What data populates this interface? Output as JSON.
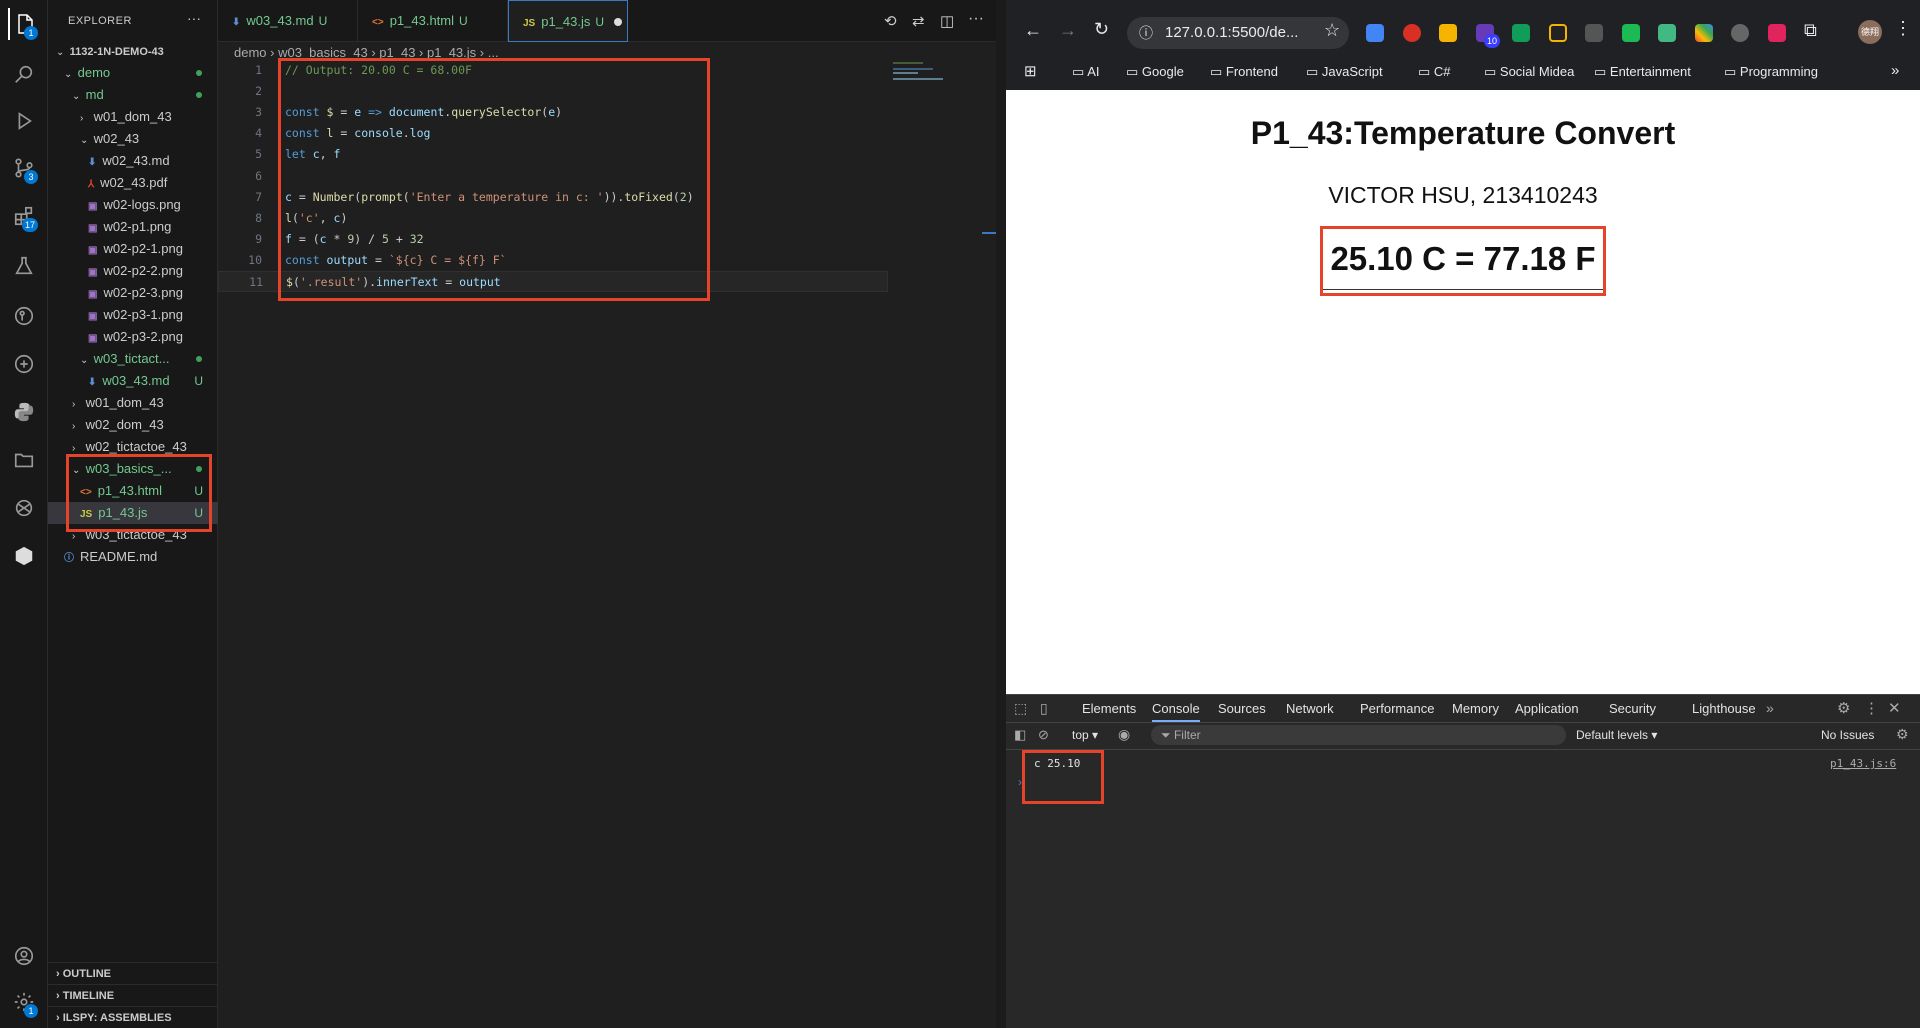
{
  "vscode": {
    "activity_badges": {
      "explorer": "1",
      "scm": "3",
      "extensions": "17",
      "settings": "1"
    },
    "explorer": {
      "title": "EXPLORER",
      "more": "···",
      "tree": [
        {
          "label": "1132-1N-DEMO-43",
          "indent": 0,
          "chev": "⌄",
          "bold": true,
          "color": "#cccccc"
        },
        {
          "label": "demo",
          "indent": 1,
          "chev": "⌄",
          "color": "#73c991",
          "dot": true
        },
        {
          "label": "md",
          "indent": 2,
          "chev": "⌄",
          "color": "#73c991",
          "dot": true
        },
        {
          "label": "w01_dom_43",
          "indent": 3,
          "chev": "›",
          "color": "#cccccc"
        },
        {
          "label": "w02_43",
          "indent": 3,
          "chev": "⌄",
          "color": "#cccccc"
        },
        {
          "label": "w02_43.md",
          "indent": 4,
          "icon": "⬇",
          "iconColor": "#5b8fd1",
          "color": "#cccccc"
        },
        {
          "label": "w02_43.pdf",
          "indent": 4,
          "icon": "⅄",
          "iconColor": "#e5442a",
          "color": "#cccccc"
        },
        {
          "label": "w02-logs.png",
          "indent": 4,
          "icon": "▣",
          "iconColor": "#a074c4",
          "color": "#cccccc"
        },
        {
          "label": "w02-p1.png",
          "indent": 4,
          "icon": "▣",
          "iconColor": "#a074c4",
          "color": "#cccccc"
        },
        {
          "label": "w02-p2-1.png",
          "indent": 4,
          "icon": "▣",
          "iconColor": "#a074c4",
          "color": "#cccccc"
        },
        {
          "label": "w02-p2-2.png",
          "indent": 4,
          "icon": "▣",
          "iconColor": "#a074c4",
          "color": "#cccccc"
        },
        {
          "label": "w02-p2-3.png",
          "indent": 4,
          "icon": "▣",
          "iconColor": "#a074c4",
          "color": "#cccccc"
        },
        {
          "label": "w02-p3-1.png",
          "indent": 4,
          "icon": "▣",
          "iconColor": "#a074c4",
          "color": "#cccccc"
        },
        {
          "label": "w02-p3-2.png",
          "indent": 4,
          "icon": "▣",
          "iconColor": "#a074c4",
          "color": "#cccccc"
        },
        {
          "label": "w03_tictact...",
          "indent": 3,
          "chev": "⌄",
          "color": "#73c991",
          "dot": true
        },
        {
          "label": "w03_43.md",
          "indent": 4,
          "icon": "⬇",
          "iconColor": "#5b8fd1",
          "color": "#73c991",
          "u": "U"
        },
        {
          "label": "w01_dom_43",
          "indent": 2,
          "chev": "›",
          "color": "#cccccc"
        },
        {
          "label": "w02_dom_43",
          "indent": 2,
          "chev": "›",
          "color": "#cccccc"
        },
        {
          "label": "w02_tictactoe_43",
          "indent": 2,
          "chev": "›",
          "color": "#cccccc"
        },
        {
          "label": "w03_basics_...",
          "indent": 2,
          "chev": "⌄",
          "color": "#73c991",
          "dot": true
        },
        {
          "label": "p1_43.html",
          "indent": 3,
          "icon": "<>",
          "iconColor": "#e37933",
          "color": "#73c991",
          "u": "U"
        },
        {
          "label": "p1_43.js",
          "indent": 3,
          "icon": "JS",
          "iconColor": "#cbcb41",
          "color": "#73c991",
          "u": "U",
          "selected": true
        },
        {
          "label": "w03_tictactoe_43",
          "indent": 2,
          "chev": "›",
          "color": "#cccccc"
        },
        {
          "label": "README.md",
          "indent": 1,
          "icon": "ⓘ",
          "iconColor": "#5b8fd1",
          "color": "#cccccc"
        }
      ],
      "bottom": [
        "OUTLINE",
        "TIMELINE",
        "ILSPY: ASSEMBLIES"
      ]
    },
    "tabs": [
      {
        "label": "w03_43.md",
        "u": "U",
        "icon": "⬇",
        "iconColor": "#5b8fd1"
      },
      {
        "label": "p1_43.html",
        "u": "U",
        "icon": "<>",
        "iconColor": "#e37933"
      },
      {
        "label": "p1_43.js",
        "u": "U",
        "icon": "JS",
        "iconColor": "#cbcb41",
        "active": true
      }
    ],
    "breadcrumb": [
      "demo",
      "w03_basics_43",
      "p1_43",
      "p1_43.js",
      "..."
    ],
    "code": [
      [
        [
          "// Output: 20.00 C = 68.00F",
          "c"
        ]
      ],
      [],
      [
        [
          "const ",
          "k"
        ],
        [
          "$ ",
          "f"
        ],
        [
          "= ",
          "t"
        ],
        [
          "e ",
          "v"
        ],
        [
          "=> ",
          "k"
        ],
        [
          "document",
          "v"
        ],
        [
          ".",
          "t"
        ],
        [
          "querySelector",
          "f"
        ],
        [
          "(",
          "t"
        ],
        [
          "e",
          "v"
        ],
        [
          ")",
          "t"
        ]
      ],
      [
        [
          "const ",
          "k"
        ],
        [
          "l ",
          "f"
        ],
        [
          "= ",
          "t"
        ],
        [
          "console",
          "v"
        ],
        [
          ".",
          "t"
        ],
        [
          "log",
          "v"
        ]
      ],
      [
        [
          "let ",
          "k"
        ],
        [
          "c",
          "v"
        ],
        [
          ", ",
          "t"
        ],
        [
          "f",
          "v"
        ]
      ],
      [],
      [
        [
          "c ",
          "v"
        ],
        [
          "= ",
          "t"
        ],
        [
          "Number",
          "f"
        ],
        [
          "(",
          "t"
        ],
        [
          "prompt",
          "f"
        ],
        [
          "(",
          "t"
        ],
        [
          "'Enter a temperature in c: '",
          "s"
        ],
        [
          ")).",
          "t"
        ],
        [
          "toFixed",
          "f"
        ],
        [
          "(",
          "t"
        ],
        [
          "2",
          "n"
        ],
        [
          ")",
          "t"
        ]
      ],
      [
        [
          "l",
          "f"
        ],
        [
          "(",
          "t"
        ],
        [
          "'c'",
          "s"
        ],
        [
          ", ",
          "t"
        ],
        [
          "c",
          "v"
        ],
        [
          ")",
          "t"
        ]
      ],
      [
        [
          "f ",
          "v"
        ],
        [
          "= (",
          "t"
        ],
        [
          "c ",
          "v"
        ],
        [
          "* ",
          "t"
        ],
        [
          "9",
          "n"
        ],
        [
          ") / ",
          "t"
        ],
        [
          "5 ",
          "n"
        ],
        [
          "+ ",
          "t"
        ],
        [
          "32",
          "n"
        ]
      ],
      [
        [
          "const ",
          "k"
        ],
        [
          "output ",
          "v"
        ],
        [
          "= ",
          "t"
        ],
        [
          "`${c} C = ${f} F`",
          "s"
        ]
      ],
      [
        [
          "$",
          "f"
        ],
        [
          "(",
          "t"
        ],
        [
          "'.result'",
          "s"
        ],
        [
          ").",
          "t"
        ],
        [
          "innerText ",
          "v"
        ],
        [
          "= ",
          "t"
        ],
        [
          "output",
          "v"
        ]
      ]
    ]
  },
  "browser": {
    "url": "127.0.0.1:5500/de...",
    "extension_badge": "10",
    "profile": "德翔",
    "bookmarks": [
      "AI",
      "Google",
      "Frontend",
      "JavaScript",
      "C#",
      "Social Midea",
      "Entertainment",
      "Programming"
    ],
    "page": {
      "title": "P1_43:Temperature Convert",
      "author": "VICTOR HSU, 213410243",
      "result": "25.10 C = 77.18 F"
    },
    "devtools": {
      "tabs": [
        "Elements",
        "Console",
        "Sources",
        "Network",
        "Performance",
        "Memory",
        "Application",
        "Security",
        "Lighthouse"
      ],
      "active_tab": "Console",
      "context": "top",
      "filter_placeholder": "Filter",
      "levels": "Default levels",
      "issues": "No Issues",
      "log_text": "c 25.10",
      "log_source": "p1_43.js:6"
    }
  }
}
